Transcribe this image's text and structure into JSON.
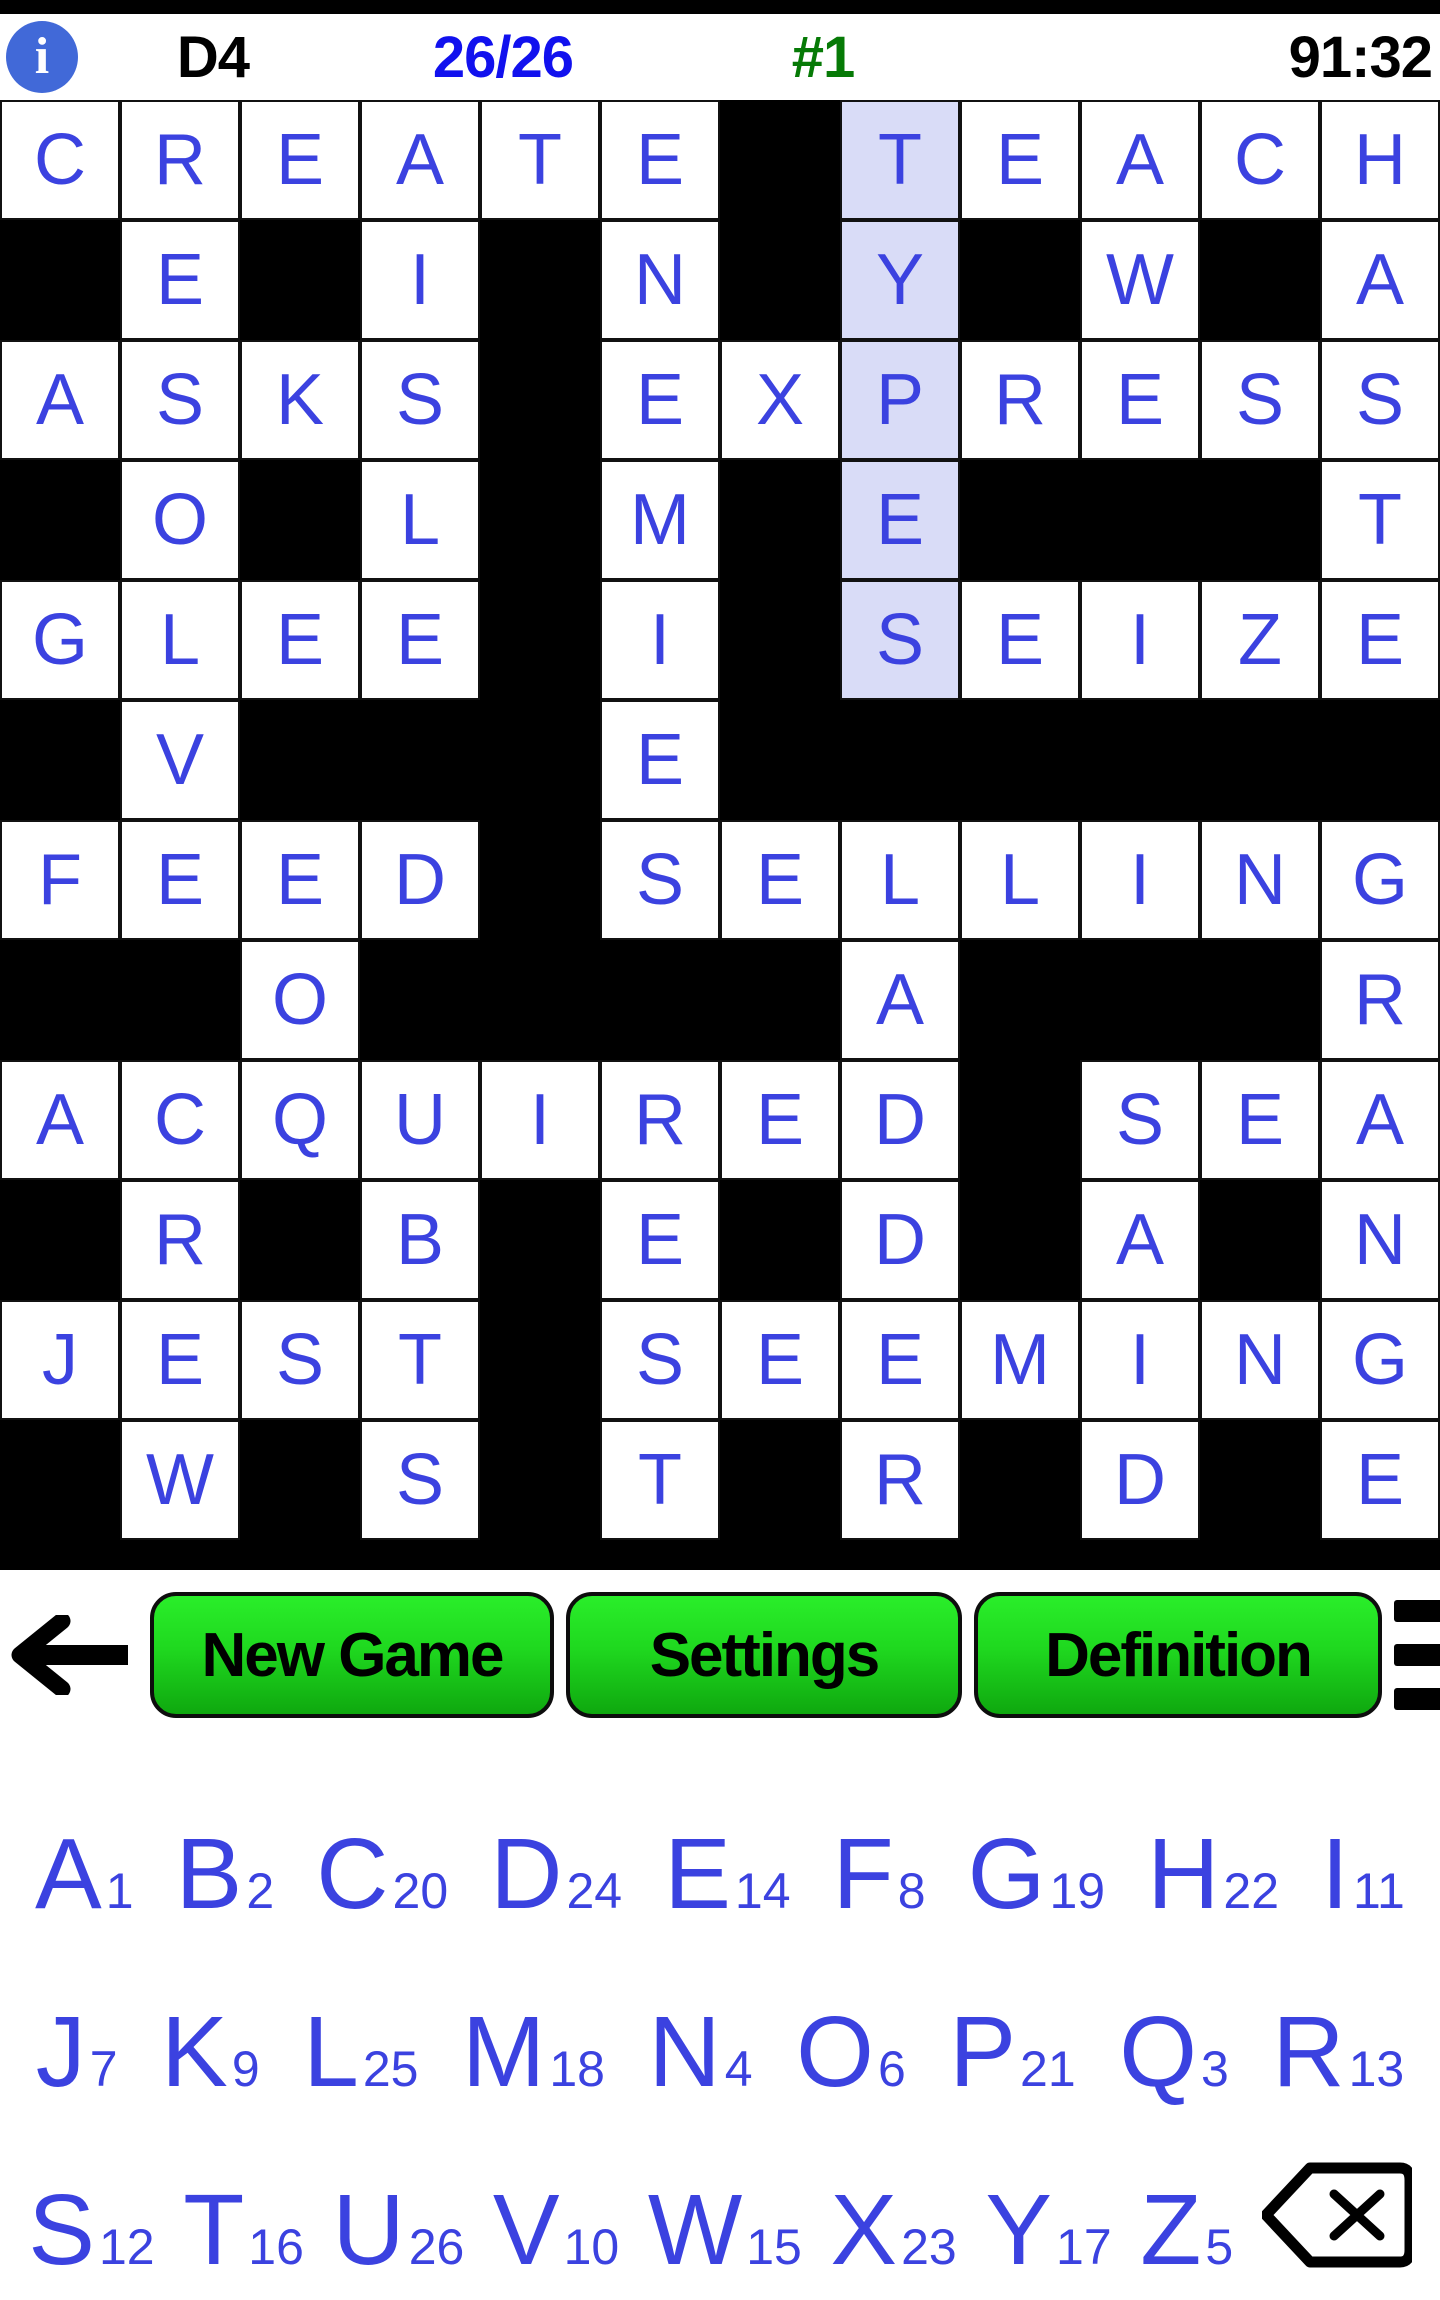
{
  "statusbar": {
    "info_icon": "info-icon",
    "level": "D4",
    "progress": "26/26",
    "rank": "#1",
    "timer": "91:32",
    "progress_color": "#1111ee",
    "rank_color": "#067a06",
    "info_color": "#4169d8"
  },
  "grid": {
    "columns": 12,
    "rows": 13,
    "letter_color": "#3b42e0",
    "block_color": "#000000",
    "open_color": "#ffffff",
    "highlight_color": "#d9dcf7",
    "highlight_column": 7,
    "rows_data": [
      [
        "C",
        "R",
        "E",
        "A",
        "T",
        "E",
        "",
        "T",
        "E",
        "A",
        "C",
        "H"
      ],
      [
        "",
        "E",
        "",
        "I",
        "",
        "N",
        "",
        "Y",
        "",
        "W",
        "",
        "A"
      ],
      [
        "A",
        "S",
        "K",
        "S",
        "",
        "E",
        "X",
        "P",
        "R",
        "E",
        "S",
        "S"
      ],
      [
        "",
        "O",
        "",
        "L",
        "",
        "M",
        "",
        "E",
        "",
        "",
        "",
        "T"
      ],
      [
        "G",
        "L",
        "E",
        "E",
        "",
        "I",
        "",
        "S",
        "E",
        "I",
        "Z",
        "E"
      ],
      [
        "",
        "V",
        "",
        "",
        "",
        "E",
        "",
        "",
        "",
        "",
        "",
        ""
      ],
      [
        "F",
        "E",
        "E",
        "D",
        "",
        "S",
        "E",
        "L",
        "L",
        "I",
        "N",
        "G"
      ],
      [
        "",
        "",
        "O",
        "",
        "",
        "",
        "",
        "A",
        "",
        "",
        "",
        "R"
      ],
      [
        "A",
        "C",
        "Q",
        "U",
        "I",
        "R",
        "E",
        "D",
        "",
        "S",
        "E",
        "A"
      ],
      [
        "",
        "R",
        "",
        "B",
        "",
        "E",
        "",
        "D",
        "",
        "A",
        "",
        "N"
      ],
      [
        "J",
        "E",
        "S",
        "T",
        "",
        "S",
        "E",
        "E",
        "M",
        "I",
        "N",
        "G"
      ],
      [
        "",
        "W",
        "",
        "S",
        "",
        "T",
        "",
        "R",
        "",
        "D",
        "",
        "E"
      ]
    ],
    "highlighted_cells": [
      [
        0,
        7
      ],
      [
        1,
        7
      ],
      [
        2,
        7
      ],
      [
        3,
        7
      ],
      [
        4,
        7
      ]
    ]
  },
  "actionbar": {
    "back_icon": "back-arrow-icon",
    "new_game_label": "New Game",
    "settings_label": "Settings",
    "definition_label": "Definition",
    "menu_icon": "hamburger-menu-icon",
    "button_color": "#1fd81f"
  },
  "keyboard": {
    "backspace_icon": "backspace-icon",
    "key_color": "#3b42e0",
    "rows": [
      [
        {
          "letter": "A",
          "count": "1"
        },
        {
          "letter": "B",
          "count": "2"
        },
        {
          "letter": "C",
          "count": "20"
        },
        {
          "letter": "D",
          "count": "24"
        },
        {
          "letter": "E",
          "count": "14"
        },
        {
          "letter": "F",
          "count": "8"
        },
        {
          "letter": "G",
          "count": "19"
        },
        {
          "letter": "H",
          "count": "22"
        },
        {
          "letter": "I",
          "count": "11"
        }
      ],
      [
        {
          "letter": "J",
          "count": "7"
        },
        {
          "letter": "K",
          "count": "9"
        },
        {
          "letter": "L",
          "count": "25"
        },
        {
          "letter": "M",
          "count": "18"
        },
        {
          "letter": "N",
          "count": "4"
        },
        {
          "letter": "O",
          "count": "6"
        },
        {
          "letter": "P",
          "count": "21"
        },
        {
          "letter": "Q",
          "count": "3"
        },
        {
          "letter": "R",
          "count": "13"
        }
      ],
      [
        {
          "letter": "S",
          "count": "12"
        },
        {
          "letter": "T",
          "count": "16"
        },
        {
          "letter": "U",
          "count": "26"
        },
        {
          "letter": "V",
          "count": "10"
        },
        {
          "letter": "W",
          "count": "15"
        },
        {
          "letter": "X",
          "count": "23"
        },
        {
          "letter": "Y",
          "count": "17"
        },
        {
          "letter": "Z",
          "count": "5"
        }
      ]
    ]
  }
}
